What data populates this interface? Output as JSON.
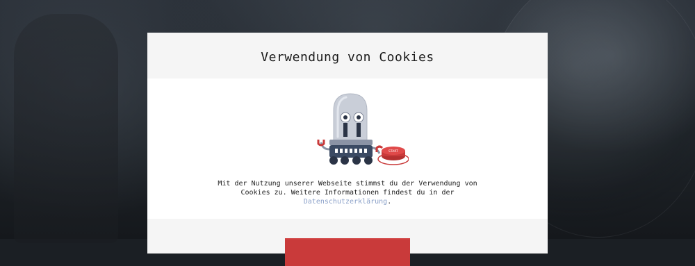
{
  "modal": {
    "title": "Verwendung von Cookies",
    "message_line1": "Mit der Nutzung unserer Webseite stimmst du der Verwendung von",
    "message_line2": "Cookies zu. Weitere Informationen findest du in der",
    "privacy_link": "Datenschutzerklärung",
    "privacy_suffix": ".",
    "accept_label": ""
  },
  "illustration": {
    "icon": "robot-pressing-button-icon",
    "button_text": "START"
  },
  "colors": {
    "header_bg": "#f5f5f5",
    "link": "#8aa0c8",
    "accent_red": "#c93a3a",
    "robot_dome": "#c9ced8",
    "robot_base": "#3b4a63"
  }
}
